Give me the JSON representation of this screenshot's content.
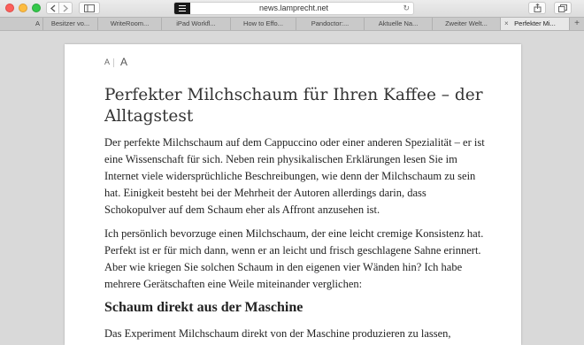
{
  "browser": {
    "url": "news.lamprecht.net",
    "tabs": [
      {
        "label": "A",
        "active": false
      },
      {
        "label": "Besitzer vo...",
        "active": false
      },
      {
        "label": "WriteRoom...",
        "active": false
      },
      {
        "label": "iPad Workfl...",
        "active": false
      },
      {
        "label": "How to Effo...",
        "active": false
      },
      {
        "label": "Pandoctor:...",
        "active": false
      },
      {
        "label": "Aktuelle Na...",
        "active": false
      },
      {
        "label": "Zweiter Welt...",
        "active": false
      },
      {
        "label": "Perfekter Mi...",
        "active": true
      }
    ],
    "new_tab_label": "+",
    "tab_close_glyph": "×"
  },
  "reader": {
    "font_small": "A",
    "font_large": "A",
    "title": "Perfekter Milchschaum für Ihren Kaffee – der Alltagstest",
    "paragraphs": [
      "Der perfekte Milchschaum auf dem Cappuccino oder einer anderen Spezialität – er ist eine Wissenschaft für sich. Neben rein physikalischen Erklärungen lesen Sie im Internet viele widersprüchliche Beschreibungen, wie denn der Milchschaum zu sein hat. Einigkeit besteht bei der Mehrheit der Autoren allerdings darin, dass Schokopulver auf dem Schaum eher als Affront anzusehen ist.",
      "Ich persönlich bevorzuge einen Milchschaum, der eine leicht cremige Konsistenz hat. Perfekt ist er für mich dann, wenn er an leicht und frisch geschlagene Sahne erinnert. Aber wie kriegen Sie solchen Schaum in den eigenen vier Wänden hin? Ich habe mehrere Gerätschaften eine Weile miteinander verglichen:"
    ],
    "subheading": "Schaum direkt aus der Maschine",
    "p3": "Das Experiment Milchschaum direkt von der Maschine produzieren zu lassen,"
  }
}
